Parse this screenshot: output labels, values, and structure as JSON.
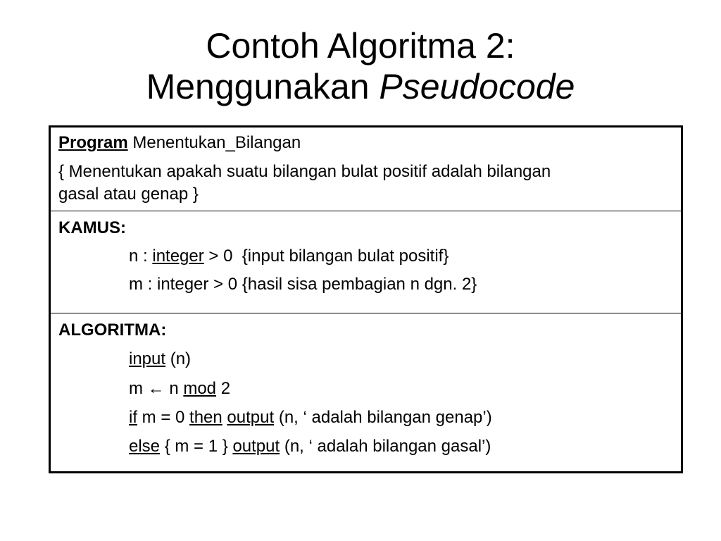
{
  "title": {
    "line1": "Contoh Algoritma 2:",
    "line2_prefix": "Menggunakan ",
    "line2_italic": "Pseudocode"
  },
  "header_section": {
    "program_keyword": "Program",
    "program_name": " Menentukan_Bilangan",
    "comment_line1": "{ Menentukan apakah suatu bilangan bulat positif adalah bilangan",
    "comment_line2": "gasal atau genap }"
  },
  "kamus_section": {
    "heading": "KAMUS:",
    "var1": {
      "name": "n : ",
      "type": "integer",
      "rest": " > 0  {input bilangan bulat positif}"
    },
    "var2": {
      "text": "m : integer > 0 {hasil sisa pembagian n dgn. 2}"
    }
  },
  "algoritma_section": {
    "heading": "ALGORITMA:",
    "line1": {
      "kw": "input",
      "rest": " (n)"
    },
    "line2": {
      "pre": "m ← n ",
      "kw": "mod",
      "rest": " 2"
    },
    "line3": {
      "kw_if": "if",
      "mid1": " m = 0 ",
      "kw_then": "then",
      "mid2": " ",
      "kw_output": "output",
      "rest": " (n, ‘ adalah bilangan genap’)"
    },
    "line4": {
      "kw_else": "else",
      "mid": " { m = 1 } ",
      "kw_output": "output",
      "rest": " (n, ‘ adalah bilangan gasal’)"
    }
  }
}
